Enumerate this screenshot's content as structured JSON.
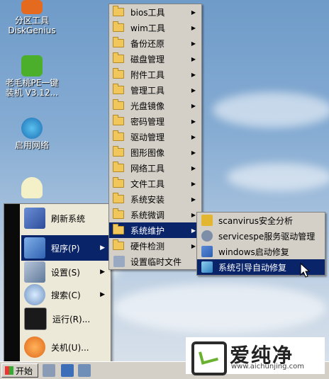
{
  "desktop": {
    "icons": [
      {
        "label": "分区工具\nDiskGenius"
      },
      {
        "label": "老毛桃PE一键\n装机 V3.12..."
      },
      {
        "label": "启用网络"
      }
    ]
  },
  "start_menu": {
    "items": [
      {
        "label": "刷新系统"
      },
      {
        "label": "程序(P)"
      },
      {
        "label": "设置(S)"
      },
      {
        "label": "搜索(C)"
      },
      {
        "label": "运行(R)..."
      },
      {
        "label": "关机(U)..."
      }
    ]
  },
  "programs_menu": {
    "items": [
      {
        "label": "bios工具"
      },
      {
        "label": "wim工具"
      },
      {
        "label": "备份还原"
      },
      {
        "label": "磁盘管理"
      },
      {
        "label": "附件工具"
      },
      {
        "label": "管理工具"
      },
      {
        "label": "光盘镜像"
      },
      {
        "label": "密码管理"
      },
      {
        "label": "驱动管理"
      },
      {
        "label": "图形图像"
      },
      {
        "label": "网络工具"
      },
      {
        "label": "文件工具"
      },
      {
        "label": "系统安装"
      },
      {
        "label": "系统微调"
      },
      {
        "label": "系统维护"
      },
      {
        "label": "硬件检测"
      },
      {
        "label": "设置临时文件"
      }
    ]
  },
  "maintenance_menu": {
    "items": [
      {
        "label": "scanvirus安全分析"
      },
      {
        "label": "servicespe服务驱动管理"
      },
      {
        "label": "windows启动修复"
      },
      {
        "label": "系统引导自动修复"
      }
    ]
  },
  "taskbar": {
    "start_label": "开始"
  },
  "watermark": {
    "title": "爱纯净",
    "url": "www.aichunjing.com"
  },
  "colors": {
    "highlight": "#0a246a",
    "menu_bg": "#d4d0c8"
  }
}
